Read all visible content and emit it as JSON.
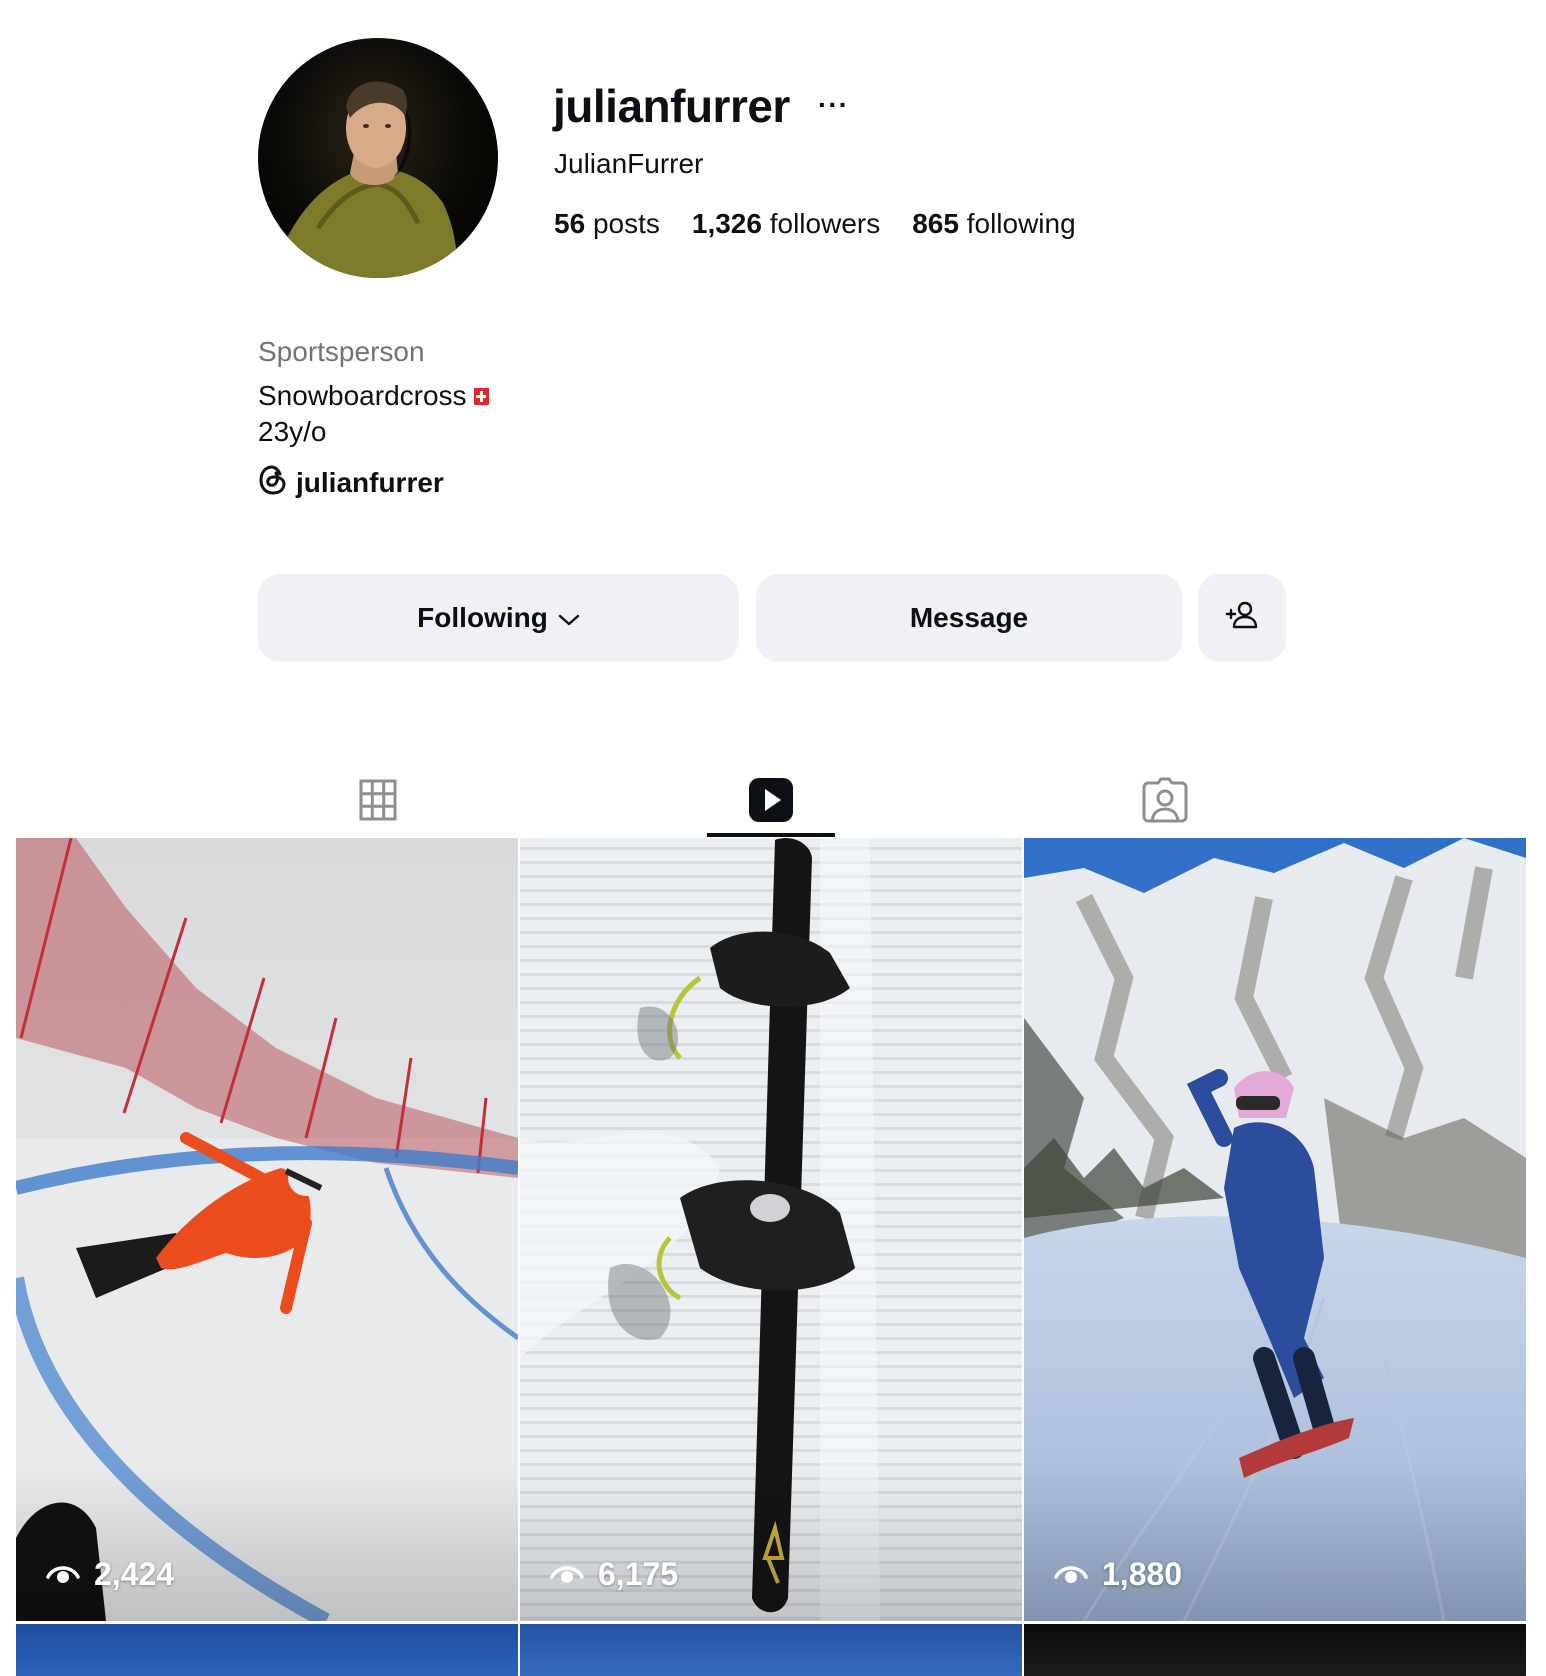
{
  "profile": {
    "username": "julianfurrer",
    "more_glyph": "···",
    "full_name": "JulianFurrer",
    "stats": [
      {
        "value": "56",
        "label": "posts"
      },
      {
        "value": "1,326",
        "label": "followers"
      },
      {
        "value": "865",
        "label": "following"
      }
    ],
    "category": "Sportsperson",
    "bio_line1": "Snowboardcross",
    "bio_line2": "23y/o",
    "threads_handle": "julianfurrer"
  },
  "actions": {
    "following_label": "Following",
    "message_label": "Message"
  },
  "tabs": [
    {
      "icon": "grid-icon",
      "selected": false
    },
    {
      "icon": "reels-icon",
      "selected": true
    },
    {
      "icon": "tagged-icon",
      "selected": false
    }
  ],
  "reels": [
    {
      "views": "2,424"
    },
    {
      "views": "6,175"
    },
    {
      "views": "1,880"
    }
  ],
  "colors": {
    "text": "#0c1014",
    "secondary_text": "#737373",
    "button_bg": "#eff1f4",
    "tab_inactive": "#8e8e8e",
    "flag_red": "#e4242b"
  }
}
